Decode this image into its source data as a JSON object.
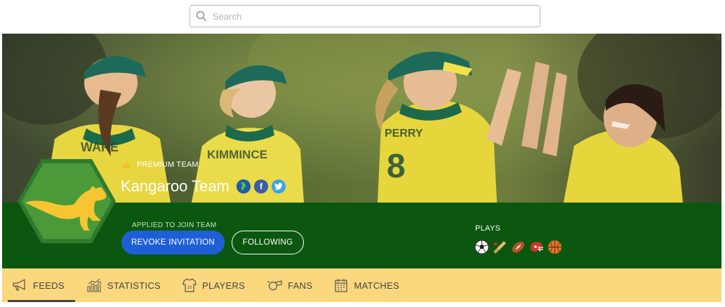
{
  "search": {
    "placeholder": "Search"
  },
  "team": {
    "badge": "PREMIUM TEAM",
    "name": "Kangaroo Team",
    "social": [
      "globe-icon",
      "facebook-icon",
      "twitter-icon"
    ]
  },
  "membership": {
    "status_label": "APPLIED TO JOIN TEAM",
    "revoke_label": "REVOKE INVITATION",
    "follow_label": "FOLLOWING"
  },
  "plays": {
    "label": "PLAYS",
    "sports": [
      "soccer-ball-icon",
      "cricket-bat-icon",
      "rugby-ball-icon",
      "football-helmet-icon",
      "basketball-icon"
    ]
  },
  "tabs": [
    {
      "label": "FEEDS",
      "icon": "megaphone-icon",
      "active": true
    },
    {
      "label": "STATISTICS",
      "icon": "bar-chart-icon",
      "active": false
    },
    {
      "label": "PLAYERS",
      "icon": "jersey-icon",
      "active": false
    },
    {
      "label": "FANS",
      "icon": "whistle-icon",
      "active": false
    },
    {
      "label": "MATCHES",
      "icon": "calendar-icon",
      "active": false
    }
  ],
  "colors": {
    "band_green": "#0c5710",
    "tab_bar": "#fbd77d",
    "primary_button": "#1f5fd6",
    "logo_green": "#4a9a3a",
    "kangaroo_gold": "#f7c531"
  }
}
